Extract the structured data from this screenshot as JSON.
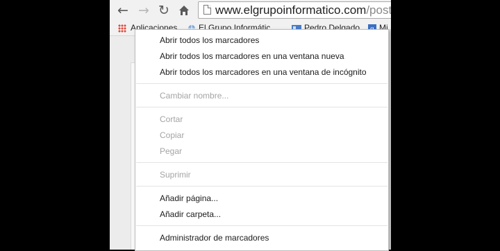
{
  "toolbar": {
    "back_icon": "arrow-left-icon",
    "forward_icon": "arrow-right-icon",
    "reload_icon": "reload-icon",
    "home_icon": "home-icon",
    "url_host": "www.elgrupoinformatico.com",
    "url_path": "/postin"
  },
  "bookmarks_bar": {
    "apps_label": "Aplicaciones",
    "items": [
      "El Grupo Informátic",
      "Pedro Delgado",
      "Mi"
    ]
  },
  "context_menu": {
    "open_all": "Abrir todos los marcadores",
    "open_all_new_window": "Abrir todos los marcadores en una ventana nueva",
    "open_all_incognito": "Abrir todos los marcadores en una ventana de incógnito",
    "rename": "Cambiar nombre...",
    "cut": "Cortar",
    "copy": "Copiar",
    "paste": "Pegar",
    "delete": "Suprimir",
    "add_page": "Añadir página...",
    "add_folder": "Añadir carpeta...",
    "bookmark_manager": "Administrador de marcadores"
  },
  "colors": {
    "apps_icon": "#e04a3c",
    "bookmark_icon": "#4a7bc8",
    "disabled_text": "#a4a4a4"
  }
}
